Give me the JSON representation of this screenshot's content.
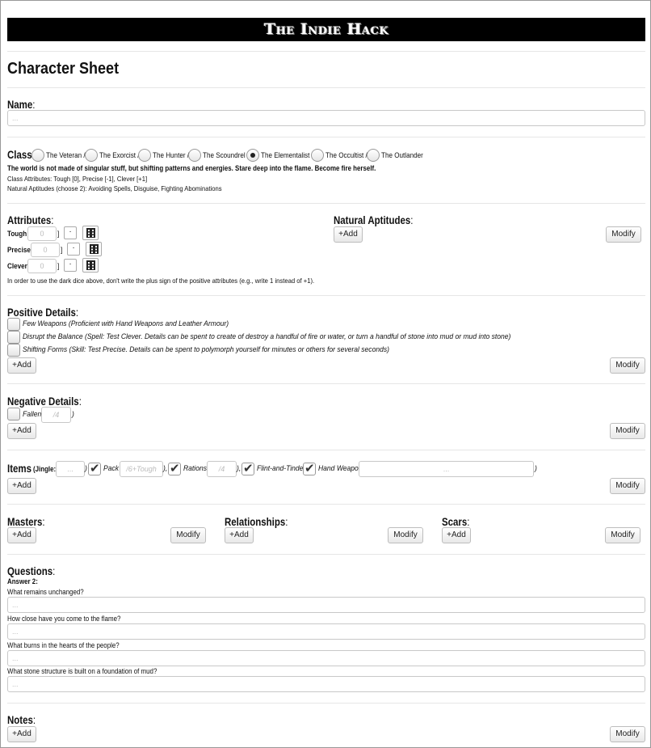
{
  "app_title": "The Indie Hack",
  "page_title": "Character Sheet",
  "name": {
    "label": "Name",
    "placeholder": "..."
  },
  "class": {
    "label": "Class",
    "options": [
      "The Veteran /",
      "The Exorcist /",
      "The Hunter /",
      "The Scoundrel /",
      "The Elementalist /",
      "The Occultist /",
      "The Outlander"
    ],
    "selected": "The Elementalist",
    "description": "The world is not made of singular stuff, but shifting patterns and energies. Stare deep into the flame. Become fire herself.",
    "attributes_line": "Class Attributes: Tough [0], Precise [-1], Clever [+1]",
    "aptitudes_line": "Natural Aptitudes (choose 2): Avoiding Spells, Disguise, Fighting Abominations"
  },
  "attributes": {
    "label": "Attributes",
    "rows": [
      {
        "name": "Tough [",
        "value": "0"
      },
      {
        "name": "Precise [",
        "value": "0"
      },
      {
        "name": "Clever [",
        "value": "0"
      }
    ],
    "close_bracket": "]",
    "note": "In order to use the dark dice above, don't write the plus sign of the positive attributes (e.g., write 1 instead of +1)."
  },
  "natural_aptitudes": {
    "label": "Natural Aptitudes"
  },
  "positive_details": {
    "label": "Positive Details",
    "items": [
      "Few Weapons (Proficient with Hand Weapons and Leather Armour)",
      "Disrupt the Balance (Spell: Test Clever. Details can be spent to create of destroy a handful of fire or water, or turn a handful of stone into mud or mud into stone)",
      "Shifting Forms (Skill: Test Precise. Details can be spent to polymorph yourself for minutes or others for several seconds)"
    ]
  },
  "negative_details": {
    "label": "Negative Details",
    "item": "Fallen (",
    "placeholder": "/4",
    "close": ")"
  },
  "items": {
    "label": "Items",
    "jingle_label": "(Jingle:",
    "jingle_placeholder": "...",
    "entries": [
      {
        "label": "Pack (",
        "placeholder": "/6+Tough",
        "close": "),"
      },
      {
        "label": "Rations (",
        "placeholder": "/4",
        "close": "),"
      },
      {
        "label": "Flint-and-Tinder,"
      },
      {
        "label": "Hand Weapon (",
        "placeholder": "...",
        "close": ")"
      }
    ]
  },
  "masters": {
    "label": "Masters"
  },
  "relationships": {
    "label": "Relationships"
  },
  "scars": {
    "label": "Scars"
  },
  "questions": {
    "label": "Questions",
    "instruction": "Answer 2:",
    "items": [
      {
        "q": "What remains unchanged?",
        "placeholder": "..."
      },
      {
        "q": "How close have you come to the flame?",
        "placeholder": "..."
      },
      {
        "q": "What burns in the hearts of the people?",
        "placeholder": "..."
      },
      {
        "q": "What stone structure is built on a foundation of mud?",
        "placeholder": "..."
      }
    ]
  },
  "notes": {
    "label": "Notes"
  },
  "buttons": {
    "add": "+Add",
    "modify": "Modify",
    "colon": ":",
    "die_small": "·"
  }
}
